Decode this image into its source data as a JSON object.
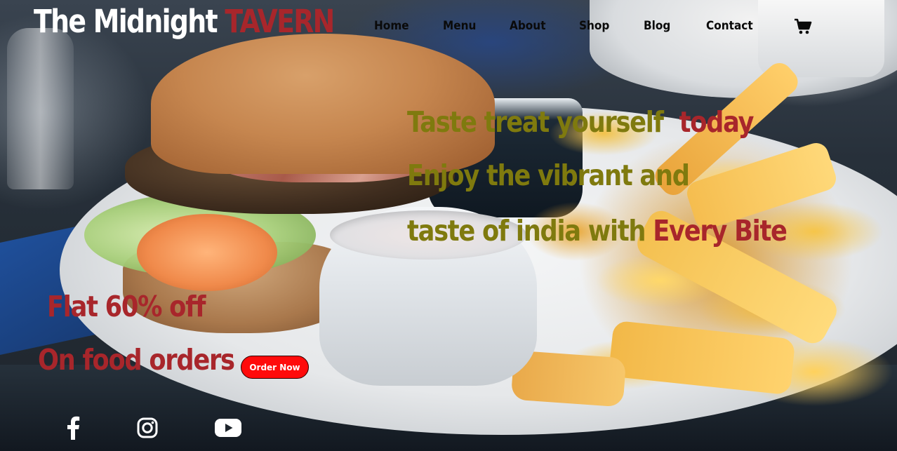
{
  "brand": {
    "part1": "The Midnight",
    "part2": "TAVERN"
  },
  "nav": {
    "items": [
      {
        "label": "Home"
      },
      {
        "label": "Menu"
      },
      {
        "label": "About"
      },
      {
        "label": "Shop"
      },
      {
        "label": "Blog"
      },
      {
        "label": "Contact"
      }
    ],
    "cart_icon": "shopping-cart-icon"
  },
  "hero": {
    "line1_a": "Taste treat yourself",
    "line1_b": "today",
    "line2": "Enjoy the vibrant and",
    "line3_a": "taste of india with",
    "line3_b": "Every Bite"
  },
  "promo": {
    "line1": "Flat 60% off",
    "line2": "On food orders",
    "button": "Order Now"
  },
  "social": [
    "facebook-icon",
    "instagram-icon",
    "youtube-icon"
  ],
  "colors": {
    "brand_white": "#ffffff",
    "accent_maroon": "#a8262b",
    "headline_olive": "#7f7a0e",
    "button_red": "#ff0b0b",
    "nav_text": "#0a0a0a"
  }
}
